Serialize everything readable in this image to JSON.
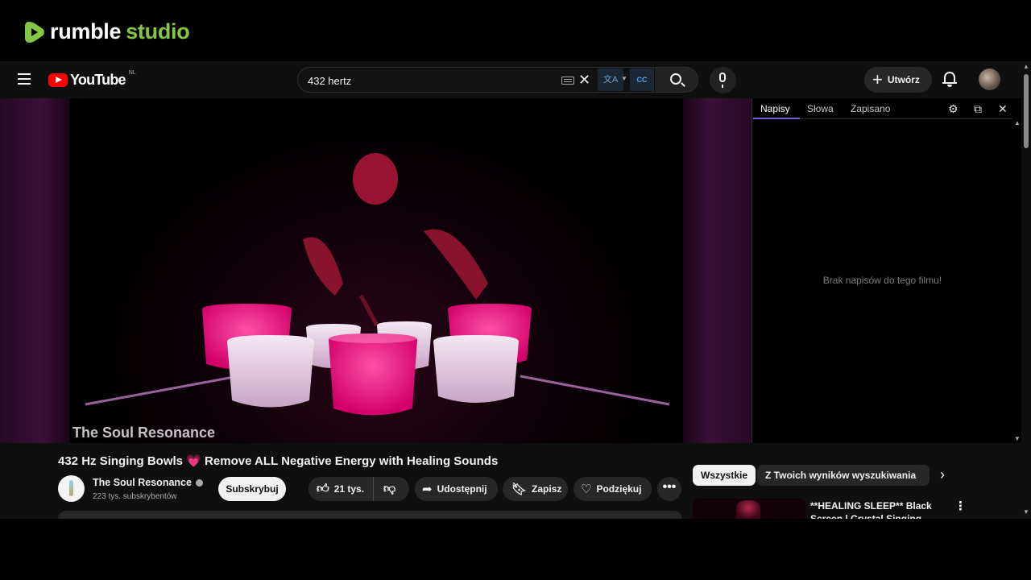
{
  "rumble": {
    "word1": "rumble",
    "word2": "studio",
    "brand_color": "#85c742"
  },
  "masthead": {
    "logo_text": "YouTube",
    "region": "NL",
    "search_value": "432 hertz",
    "clear": "✕",
    "translate_icon": "文A",
    "cc_icon": "CC",
    "create_label": "Utwórz"
  },
  "player": {
    "watermark": "The Soul Resonance"
  },
  "captions": {
    "tabs": [
      "Napisy",
      "Słowa",
      "Zapisano"
    ],
    "empty_message": "Brak napisów do tego filmu!"
  },
  "video": {
    "title_part1": "432 Hz Singing Bowls ",
    "title_emoji": "💗",
    "title_part2": " Remove ALL Negative Energy with Healing Sounds",
    "channel_name": "The Soul Resonance",
    "subscribers": "223 tys. subskrybentów",
    "subscribe_label": "Subskrybuj",
    "likes": "21 tys.",
    "share_label": "Udostępnij",
    "save_label": "Zapisz",
    "thanks_label": "Podziękuj",
    "more": "•••"
  },
  "chips": [
    "Wszystkie",
    "Z Twoich wyników wyszukiwania"
  ],
  "recommendation": {
    "title": "**HEALING SLEEP** Black Screen | Crystal Singing Bowls"
  }
}
